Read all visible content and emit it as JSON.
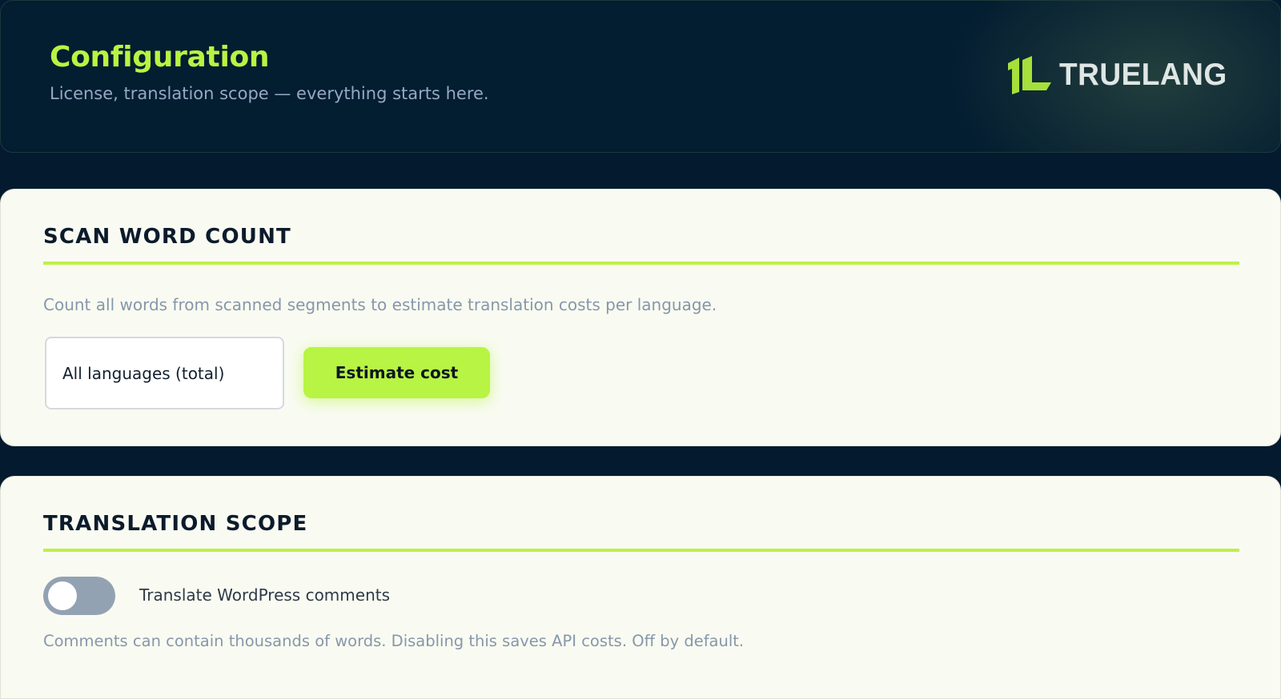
{
  "header": {
    "title": "Configuration",
    "subtitle": "License, translation scope — everything starts here.",
    "brand": "TRUELANG"
  },
  "word_count": {
    "title": "SCAN WORD COUNT",
    "description": "Count all words from scanned segments to estimate translation costs per language.",
    "language_select_value": "All languages (total)",
    "estimate_button": "Estimate cost"
  },
  "translation_scope": {
    "title": "TRANSLATION SCOPE",
    "toggle_label": "Translate WordPress comments",
    "toggle_on": false,
    "description": "Comments can contain thousands of words. Disabling this saves API costs. Off by default."
  },
  "colors": {
    "accent": "#b8f443",
    "background": "#031a2f",
    "card": "#f9fbf2",
    "muted_text": "#8797aa",
    "toggle_off": "#93a2b3"
  }
}
